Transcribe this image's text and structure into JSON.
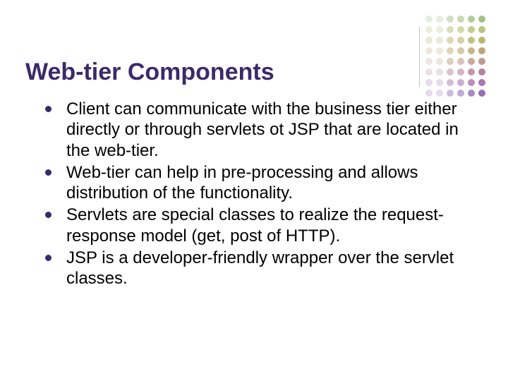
{
  "title": "Web-tier Components",
  "bullets": [
    "Client can communicate with the business tier either directly or through servlets ot JSP that are located in the web-tier.",
    "Web-tier can help in pre-processing and allows distribution of the functionality.",
    "Servlets are special classes to realize the request-response model (get, post of HTTP).",
    "JSP is a developer-friendly wrapper over the servlet classes."
  ]
}
